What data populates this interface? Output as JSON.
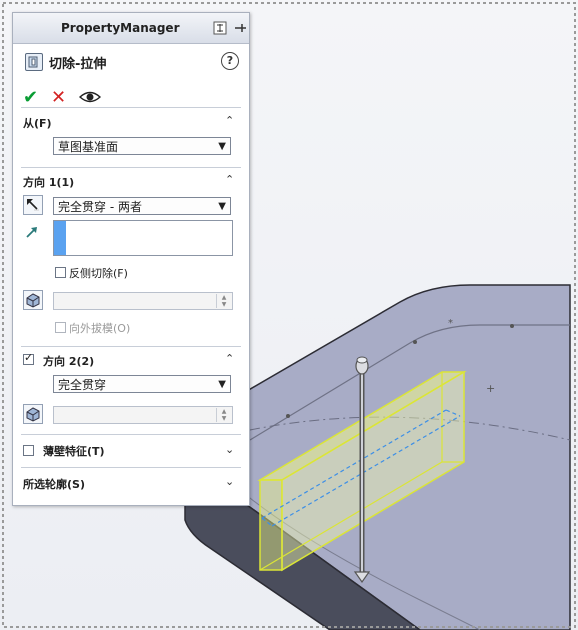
{
  "property_manager": {
    "title": "PropertyManager",
    "feature_title": "切除-拉伸",
    "help_glyph": "?",
    "ok_glyph": "✔",
    "cancel_glyph": "✕",
    "from": {
      "title": "从(F)",
      "selected": "草图基准面"
    },
    "direction1": {
      "title": "方向 1(1)",
      "end_condition": "完全贯穿 - 两者",
      "flip_side_label": "反侧切除(F)",
      "flip_side_checked": false,
      "draft_outward_label": "向外拔模(O)",
      "draft_outward_checked": false
    },
    "direction2": {
      "title": "方向 2(2)",
      "checked": true,
      "end_condition": "完全贯穿"
    },
    "thin_feature": {
      "title": "薄壁特征(T)",
      "checked": false
    },
    "selected_contours": {
      "title": "所选轮廓(S)"
    },
    "chevron_up": "⌃",
    "chevron_down": "⌄",
    "combo_arrow": "▼"
  },
  "colors": {
    "check_green": "#0a9d34",
    "cancel_red": "#d32222",
    "selection_blue": "#5aa2f0",
    "preview_yellow": "#e6f04a",
    "solid_dark": "#4a4d5c",
    "solid_face": "#a9adc6"
  }
}
